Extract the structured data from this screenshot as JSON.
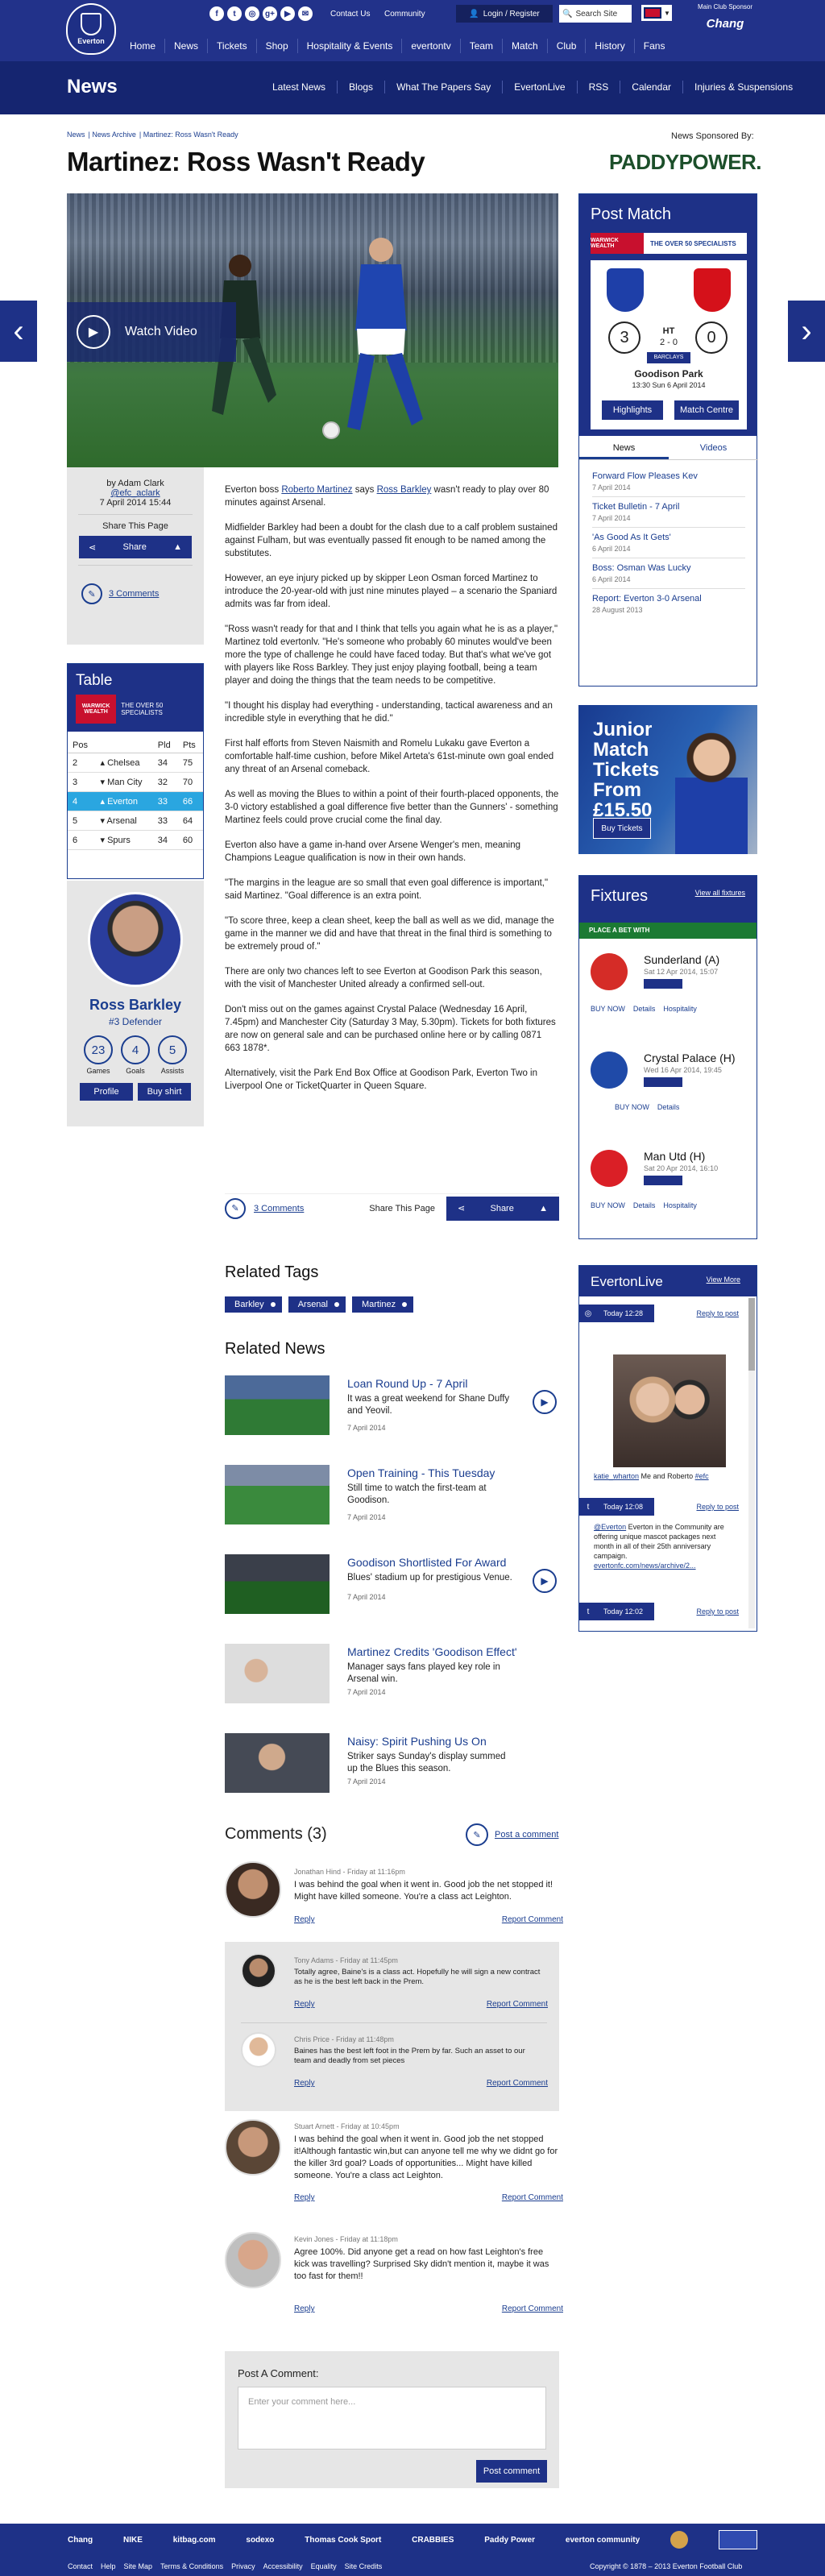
{
  "header": {
    "logo_text": "Everton",
    "social": [
      "f",
      "t",
      "◎",
      "g+",
      "▶",
      "✉"
    ],
    "contact": "Contact Us",
    "community": "Community",
    "login": "Login / Register",
    "search_placeholder": "Search Site",
    "sponsor_label": "Main Club Sponsor",
    "sponsor_name": "Chang",
    "nav": [
      "Home",
      "News",
      "Tickets",
      "Shop",
      "Hospitality & Events",
      "evertontv",
      "Team",
      "Match",
      "Club",
      "History",
      "Fans"
    ]
  },
  "subheader": {
    "title": "News",
    "nav": [
      "Latest News",
      "Blogs",
      "What The Papers Say",
      "EvertonLive",
      "RSS",
      "Calendar",
      "Injuries & Suspensions"
    ]
  },
  "breadcrumb": [
    "News",
    "News Archive",
    "Martinez: Ross Wasn't Ready"
  ],
  "news_sponsored_by": "News Sponsored By:",
  "paddypower": "PADDYPOWER.",
  "article": {
    "title": "Martinez: Ross Wasn't Ready",
    "watch_video": "Watch Video",
    "by": "by Adam Clark",
    "twitter": "@efc_aclark",
    "date": "7 April 2014 15:44",
    "share_page": "Share This Page",
    "share": "Share",
    "comments_link": "3 Comments",
    "p1a": "Everton boss ",
    "p1link1": "Roberto Martinez",
    "p1b": " says ",
    "p1link2": "Ross Barkley",
    "p1c": " wasn't ready to play over 80 minutes against Arsenal.",
    "paras": [
      "Midfielder Barkley had been a doubt for the clash due to a calf problem sustained against Fulham, but was eventually passed fit enough to be named among the substitutes.",
      "However, an eye injury picked up by skipper Leon Osman forced Martinez to introduce the 20-year-old with just nine minutes played – a scenario the Spaniard admits was far from ideal.",
      "\"Ross wasn't ready for that and I think that tells you again what he is as a player,\" Martinez told evertonlv. \"He's someone who probably 60 minutes would've been more the type of challenge he could have faced  today. But that's what we've got with players like Ross Barkley. They just enjoy playing football, being a team player and doing the things that the team needs to be competitive.",
      "\"I thought his display had everything - understanding, tactical awareness and an incredible style in everything that he did.\"",
      "First half efforts from Steven Naismith and Romelu Lukaku gave Everton a comfortable half-time cushion, before Mikel Arteta's 61st-minute own goal ended any threat of an Arsenal comeback.",
      "As well as moving the Blues to within a point of their fourth-placed opponents, the 3-0 victory established a goal difference five better than the Gunners' - something Martinez feels could prove crucial come the final day.",
      "Everton also have a game in-hand over Arsene Wenger's men, meaning Champions League qualification is now in their own hands.",
      "\"The margins in the league are so small that even goal difference is important,\" said Martinez. \"Goal difference is an extra point.",
      "\"To score three, keep a clean sheet, keep the ball as well as we did, manage the game in the manner we did and have that threat in the final third is something to be extremely proud of.\"",
      "There are only two chances left to see Everton at Goodison Park this season, with the visit of Manchester United already a confirmed sell-out.",
      "Don't miss out on the games against Crystal Palace (Wednesday 16 April, 7.45pm) and Manchester City (Saturday 3 May, 5.30pm). Tickets for both fixtures are now on general sale and can be purchased online here or by calling 0871 663 1878*.",
      "Alternatively, visit the Park End Box Office at Goodison Park, Everton Two in Liverpool One or TicketQuarter in Queen Square."
    ]
  },
  "table": {
    "title": "Table",
    "sponsor1": "WARWICK WEALTH",
    "sponsor2": "THE OVER 50 SPECIALISTS",
    "cols": [
      "Pos",
      "",
      "Pld",
      "Pts"
    ],
    "rows": [
      [
        "2",
        "Chelsea",
        "34",
        "75"
      ],
      [
        "3",
        "Man City",
        "32",
        "70"
      ],
      [
        "4",
        "Everton",
        "33",
        "66"
      ],
      [
        "5",
        "Arsenal",
        "33",
        "64"
      ],
      [
        "6",
        "Spurs",
        "34",
        "60"
      ]
    ]
  },
  "player": {
    "name": "Ross Barkley",
    "pos": "#3 Defender",
    "stats": [
      {
        "v": "23",
        "l": "Games"
      },
      {
        "v": "4",
        "l": "Goals"
      },
      {
        "v": "5",
        "l": "Assists"
      }
    ],
    "profile": "Profile",
    "buy": "Buy shirt"
  },
  "related_tags": {
    "title": "Related Tags",
    "tags": [
      "Barkley",
      "Arsenal",
      "Martinez"
    ]
  },
  "related_news": {
    "title": "Related News",
    "items": [
      {
        "t": "Loan Round Up - 7 April",
        "d": "It was a great weekend for Shane Duffy and Yeovil.",
        "dt": "7 April 2014"
      },
      {
        "t": "Open Training - This Tuesday",
        "d": "Still time to watch the first-team at Goodison.",
        "dt": "7 April 2014"
      },
      {
        "t": "Goodison Shortlisted For Award",
        "d": "Blues' stadium up for prestigious Venue.",
        "dt": "7 April 2014"
      },
      {
        "t": "Martinez Credits 'Goodison Effect'",
        "d": "Manager says fans played key role in Arsenal win.",
        "dt": "7 April 2014"
      },
      {
        "t": "Naisy: Spirit Pushing Us On",
        "d": "Striker says Sunday's display summed up the Blues this season.",
        "dt": "7 April 2014"
      }
    ]
  },
  "comments": {
    "title": "Comments (3)",
    "post": "Post a comment",
    "reply": "Reply",
    "report": "Report Comment",
    "items": [
      {
        "who": "Jonathan Hind - Friday at 11:16pm",
        "txt": "I was behind the goal when it went in. Good job the net stopped it! Might have killed someone. You're a class act Leighton."
      },
      {
        "who": "Tony Adams - Friday at 11:45pm",
        "txt": "Totally agree, Baine's is a class act. Hopefully he will sign a new contract as he is the best left back in the Prem."
      },
      {
        "who": "Chris Price - Friday at 11:48pm",
        "txt": "Baines has the best left foot in the Prem by far. Such an asset to our team and deadly from set pieces"
      },
      {
        "who": "Stuart Arnett - Friday at 10:45pm",
        "txt": "I was behind the goal when it went in. Good job the net stopped it!Although fantastic win,but can anyone tell me why we didnt go for the killer 3rd goal?  Loads of opportunities... Might have killed someone. You're a class act Leighton."
      },
      {
        "who": "Kevin Jones - Friday at 11:18pm",
        "txt": "Agree 100%. Did anyone get a read on how fast Leighton's free kick was travelling? Surprised Sky didn't mention it, maybe it was too fast for them!!"
      }
    ],
    "post_label": "Post A Comment:",
    "placeholder": "Enter your comment here...",
    "post_btn": "Post comment"
  },
  "postmatch": {
    "title": "Post Match",
    "sponsor1": "WARWICK WEALTH",
    "sponsor2": "THE OVER 50 SPECIALISTS",
    "home": "Everton",
    "away": "Arsenal",
    "home_score": "3",
    "away_score": "0",
    "ht": "HT",
    "ht_score": "2 - 0",
    "comp": "BARCLAYS",
    "venue": "Goodison Park",
    "when": "13:30 Sun 6 April 2014",
    "highlights": "Highlights",
    "centre": "Match Centre",
    "tab_news": "News",
    "tab_videos": "Videos",
    "items": [
      {
        "a": "Forward Flow Pleases Kev",
        "b": "7 April 2014"
      },
      {
        "a": "Ticket Bulletin - 7 April",
        "b": "7 April 2014"
      },
      {
        "a": "'As Good As It Gets'",
        "b": "6 April 2014"
      },
      {
        "a": "Boss: Osman Was Lucky",
        "b": "6 April 2014"
      },
      {
        "a": "Report: Everton 3-0 Arsenal",
        "b": "28 August 2013"
      }
    ]
  },
  "junior": {
    "line1": "Junior",
    "line2": "Match",
    "line3": "Tickets",
    "line4": "From",
    "line5": "£15.50",
    "btn": "Buy Tickets"
  },
  "fixtures": {
    "title": "Fixtures",
    "view_all": "View all fixtures",
    "bet": "PLACE A BET WITH",
    "buy": "BUY NOW",
    "details": "Details",
    "hospitality": "Hospitality",
    "items": [
      {
        "n": "Sunderland (A)",
        "d": "Sat 12 Apr 2014, 15:07",
        "c": "#d52c27"
      },
      {
        "n": "Crystal Palace (H)",
        "d": "Wed 16 Apr 2014, 19:45",
        "c": "#1f4aa8"
      },
      {
        "n": "Man Utd (H)",
        "d": "Sat 20 Apr 2014, 16:10",
        "c": "#da1f26"
      }
    ]
  },
  "elive": {
    "title": "EvertonLive",
    "view_more": "View More",
    "t1": "Today 12:28",
    "t2": "Today 12:08",
    "t3": "Today 12:02",
    "reply": "Reply to post",
    "cap_user": "katie_wharton",
    "cap_text": " Me and Roberto ",
    "cap_tag": "#efc",
    "tw_user": "@Everton",
    "tw_text": " Everton in the Community are offering unique mascot packages next month in all of their 25th anniversary campaign.",
    "tw_link": "evertonfc.com/news/archive/2..."
  },
  "footer": {
    "logos": [
      "Chang",
      "NIKE",
      "kitbag.com",
      "sodexo",
      "Thomas Cook Sport",
      "CRABBIES",
      "Paddy Power",
      "everton community"
    ],
    "links": [
      "Contact",
      "Help",
      "Site Map",
      "Terms & Conditions",
      "Privacy",
      "Accessibility",
      "Equality",
      "Site Credits"
    ],
    "copy": "Copyright © 1878 – 2013 Everton Football Club"
  }
}
